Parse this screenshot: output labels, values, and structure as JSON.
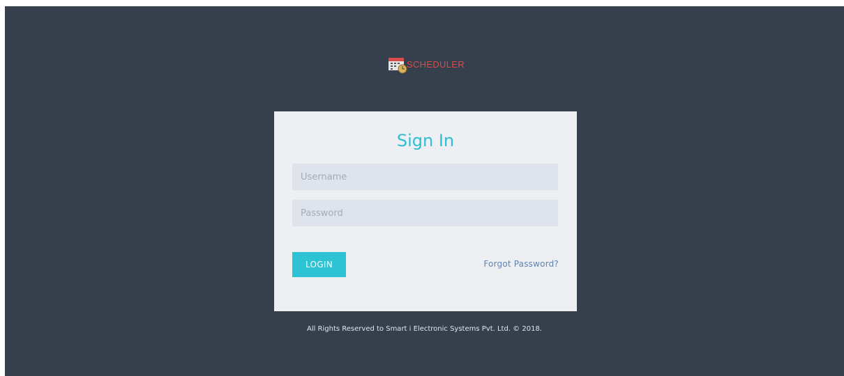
{
  "logo": {
    "text": "SCHEDULER",
    "icon": "calendar-clock-icon"
  },
  "signin": {
    "title": "Sign In",
    "username_placeholder": "Username",
    "username_value": "",
    "password_placeholder": "Password",
    "password_value": "",
    "login_label": "LOGIN",
    "forgot_label": "Forgot Password?"
  },
  "footer": {
    "text": "All Rights Reserved to Smart i Electronic Systems Pvt. Ltd. © 2018."
  },
  "colors": {
    "background": "#36404d",
    "card": "#edeff3",
    "accent": "#2ec3d3",
    "brand": "#d94a4a",
    "link": "#5d84b0"
  }
}
